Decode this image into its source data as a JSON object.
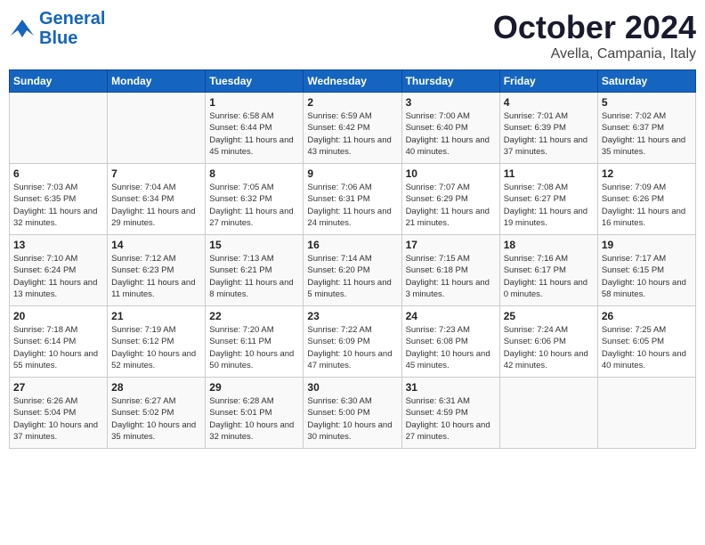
{
  "header": {
    "logo": {
      "general": "General",
      "blue": "Blue"
    },
    "month": "October 2024",
    "location": "Avella, Campania, Italy"
  },
  "weekdays": [
    "Sunday",
    "Monday",
    "Tuesday",
    "Wednesday",
    "Thursday",
    "Friday",
    "Saturday"
  ],
  "weeks": [
    [
      {
        "day": "",
        "info": ""
      },
      {
        "day": "",
        "info": ""
      },
      {
        "day": "1",
        "info": "Sunrise: 6:58 AM\nSunset: 6:44 PM\nDaylight: 11 hours and 45 minutes."
      },
      {
        "day": "2",
        "info": "Sunrise: 6:59 AM\nSunset: 6:42 PM\nDaylight: 11 hours and 43 minutes."
      },
      {
        "day": "3",
        "info": "Sunrise: 7:00 AM\nSunset: 6:40 PM\nDaylight: 11 hours and 40 minutes."
      },
      {
        "day": "4",
        "info": "Sunrise: 7:01 AM\nSunset: 6:39 PM\nDaylight: 11 hours and 37 minutes."
      },
      {
        "day": "5",
        "info": "Sunrise: 7:02 AM\nSunset: 6:37 PM\nDaylight: 11 hours and 35 minutes."
      }
    ],
    [
      {
        "day": "6",
        "info": "Sunrise: 7:03 AM\nSunset: 6:35 PM\nDaylight: 11 hours and 32 minutes."
      },
      {
        "day": "7",
        "info": "Sunrise: 7:04 AM\nSunset: 6:34 PM\nDaylight: 11 hours and 29 minutes."
      },
      {
        "day": "8",
        "info": "Sunrise: 7:05 AM\nSunset: 6:32 PM\nDaylight: 11 hours and 27 minutes."
      },
      {
        "day": "9",
        "info": "Sunrise: 7:06 AM\nSunset: 6:31 PM\nDaylight: 11 hours and 24 minutes."
      },
      {
        "day": "10",
        "info": "Sunrise: 7:07 AM\nSunset: 6:29 PM\nDaylight: 11 hours and 21 minutes."
      },
      {
        "day": "11",
        "info": "Sunrise: 7:08 AM\nSunset: 6:27 PM\nDaylight: 11 hours and 19 minutes."
      },
      {
        "day": "12",
        "info": "Sunrise: 7:09 AM\nSunset: 6:26 PM\nDaylight: 11 hours and 16 minutes."
      }
    ],
    [
      {
        "day": "13",
        "info": "Sunrise: 7:10 AM\nSunset: 6:24 PM\nDaylight: 11 hours and 13 minutes."
      },
      {
        "day": "14",
        "info": "Sunrise: 7:12 AM\nSunset: 6:23 PM\nDaylight: 11 hours and 11 minutes."
      },
      {
        "day": "15",
        "info": "Sunrise: 7:13 AM\nSunset: 6:21 PM\nDaylight: 11 hours and 8 minutes."
      },
      {
        "day": "16",
        "info": "Sunrise: 7:14 AM\nSunset: 6:20 PM\nDaylight: 11 hours and 5 minutes."
      },
      {
        "day": "17",
        "info": "Sunrise: 7:15 AM\nSunset: 6:18 PM\nDaylight: 11 hours and 3 minutes."
      },
      {
        "day": "18",
        "info": "Sunrise: 7:16 AM\nSunset: 6:17 PM\nDaylight: 11 hours and 0 minutes."
      },
      {
        "day": "19",
        "info": "Sunrise: 7:17 AM\nSunset: 6:15 PM\nDaylight: 10 hours and 58 minutes."
      }
    ],
    [
      {
        "day": "20",
        "info": "Sunrise: 7:18 AM\nSunset: 6:14 PM\nDaylight: 10 hours and 55 minutes."
      },
      {
        "day": "21",
        "info": "Sunrise: 7:19 AM\nSunset: 6:12 PM\nDaylight: 10 hours and 52 minutes."
      },
      {
        "day": "22",
        "info": "Sunrise: 7:20 AM\nSunset: 6:11 PM\nDaylight: 10 hours and 50 minutes."
      },
      {
        "day": "23",
        "info": "Sunrise: 7:22 AM\nSunset: 6:09 PM\nDaylight: 10 hours and 47 minutes."
      },
      {
        "day": "24",
        "info": "Sunrise: 7:23 AM\nSunset: 6:08 PM\nDaylight: 10 hours and 45 minutes."
      },
      {
        "day": "25",
        "info": "Sunrise: 7:24 AM\nSunset: 6:06 PM\nDaylight: 10 hours and 42 minutes."
      },
      {
        "day": "26",
        "info": "Sunrise: 7:25 AM\nSunset: 6:05 PM\nDaylight: 10 hours and 40 minutes."
      }
    ],
    [
      {
        "day": "27",
        "info": "Sunrise: 6:26 AM\nSunset: 5:04 PM\nDaylight: 10 hours and 37 minutes."
      },
      {
        "day": "28",
        "info": "Sunrise: 6:27 AM\nSunset: 5:02 PM\nDaylight: 10 hours and 35 minutes."
      },
      {
        "day": "29",
        "info": "Sunrise: 6:28 AM\nSunset: 5:01 PM\nDaylight: 10 hours and 32 minutes."
      },
      {
        "day": "30",
        "info": "Sunrise: 6:30 AM\nSunset: 5:00 PM\nDaylight: 10 hours and 30 minutes."
      },
      {
        "day": "31",
        "info": "Sunrise: 6:31 AM\nSunset: 4:59 PM\nDaylight: 10 hours and 27 minutes."
      },
      {
        "day": "",
        "info": ""
      },
      {
        "day": "",
        "info": ""
      }
    ]
  ]
}
